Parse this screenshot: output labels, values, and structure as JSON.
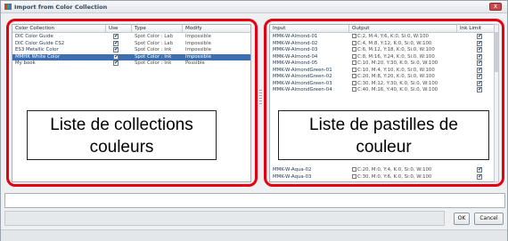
{
  "window": {
    "title": "Import from Color Collection",
    "close_label": "x"
  },
  "collections": {
    "columns": [
      "Color Collection",
      "Use",
      "Type",
      "Modify"
    ],
    "rows": [
      {
        "name": "DIC Color Guide",
        "use": true,
        "type": "Spot Color : Lab",
        "modify": "Impossible",
        "selected": false
      },
      {
        "name": "DIC Color Guide CS2",
        "use": true,
        "type": "Spot Color : Lab",
        "modify": "Impossible",
        "selected": false
      },
      {
        "name": "ES3 Metallic Color",
        "use": true,
        "type": "Spot Color : Ink",
        "modify": "Impossible",
        "selected": false
      },
      {
        "name": "MMHK White Color",
        "use": true,
        "type": "Spot Color : Ink",
        "modify": "Impossible",
        "selected": true
      },
      {
        "name": "My book",
        "use": true,
        "type": "Spot Color : Ink",
        "modify": "Possible",
        "selected": false
      }
    ],
    "overlay_label_line1": "Liste de collections",
    "overlay_label_line2": "couleurs"
  },
  "swatches": {
    "columns": [
      "Input",
      "Output",
      "Ink Limit"
    ],
    "rows": [
      {
        "input": "MMK-W-Almond-01",
        "output": "C:2, M:4, Y:6, K:0, Si:0, W:100"
      },
      {
        "input": "MMK-W-Almond-02",
        "output": "C:4, M:8, Y:12, K:0, Si:0, W:100"
      },
      {
        "input": "MMK-W-Almond-03",
        "output": "C:6, M:12, Y:18, K:0, Si:0, W:100"
      },
      {
        "input": "MMK-W-Almond-04",
        "output": "C:8, M:16, Y:24, K:0, Si:0, W:100"
      },
      {
        "input": "MMK-W-Almond-05",
        "output": "C:10, M:20, Y:30, K:0, Si:0, W:100"
      },
      {
        "input": "MMK-W-AlmondGreen-01",
        "output": "C:10, M:4, Y:10, K:0, Si:0, W:100"
      },
      {
        "input": "MMK-W-AlmondGreen-02",
        "output": "C:20, M:8, Y:20, K:0, Si:0, W:100"
      },
      {
        "input": "MMK-W-AlmondGreen-03",
        "output": "C:30, M:12, Y:30, K:0, Si:0, W:100"
      },
      {
        "input": "MMK-W-AlmondGreen-04",
        "output": "C:40, M:16, Y:40, K:0, Si:0, W:100"
      },
      {
        "input": "MMK-W-Aqua-02",
        "output": "C:20, M:0, Y:4, K:0, Si:0, W:100"
      },
      {
        "input": "MMK-W-Aqua-03",
        "output": "C:30, M:0, Y:6, K:0, Si:0, W:100"
      }
    ],
    "overlay_label_line1": "Liste de pastilles de",
    "overlay_label_line2": "couleur"
  },
  "buttons": {
    "ok": "OK",
    "cancel": "Cancel"
  },
  "colors": {
    "highlight": "#e60012",
    "selection": "#3d6fb0"
  }
}
